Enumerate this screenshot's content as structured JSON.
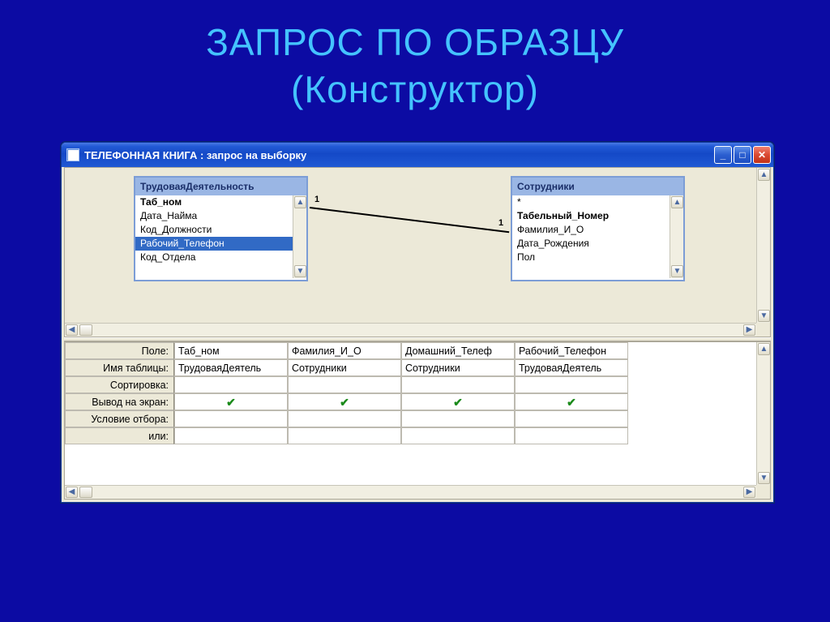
{
  "slide_title": "ЗАПРОС ПО ОБРАЗЦУ\n(Конструктор)",
  "window": {
    "title": "ТЕЛЕФОННАЯ КНИГА : запрос на выборку",
    "buttons": {
      "min": "_",
      "max": "□",
      "close": "✕"
    }
  },
  "tables": {
    "left": {
      "title": "ТрудоваяДеятельность",
      "items": [
        "Таб_ном",
        "Дата_Найма",
        "Код_Должности",
        "Рабочий_Телефон",
        "Код_Отдела"
      ],
      "selected_index": 3,
      "key_index": 0
    },
    "right": {
      "title": "Сотрудники",
      "items": [
        "*",
        "Табельный_Номер",
        "Фамилия_И_О",
        "Дата_Рождения",
        "Пол"
      ],
      "selected_index": -1,
      "key_index": 1
    }
  },
  "relation": {
    "left_label": "1",
    "right_label": "1"
  },
  "grid": {
    "row_labels": [
      "Поле:",
      "Имя таблицы:",
      "Сортировка:",
      "Вывод на экран:",
      "Условие отбора:",
      "или:"
    ],
    "columns": [
      {
        "field": "Таб_ном",
        "table": "ТрудоваяДеятель",
        "sort": "",
        "show": true,
        "criteria": "",
        "or": ""
      },
      {
        "field": "Фамилия_И_О",
        "table": "Сотрудники",
        "sort": "",
        "show": true,
        "criteria": "",
        "or": ""
      },
      {
        "field": "Домашний_Телеф",
        "table": "Сотрудники",
        "sort": "",
        "show": true,
        "criteria": "",
        "or": ""
      },
      {
        "field": "Рабочий_Телефон",
        "table": "ТрудоваяДеятель",
        "sort": "",
        "show": true,
        "criteria": "",
        "or": ""
      }
    ]
  },
  "glyphs": {
    "up": "▲",
    "down": "▼",
    "left": "◀",
    "right": "▶",
    "check": "✔"
  }
}
